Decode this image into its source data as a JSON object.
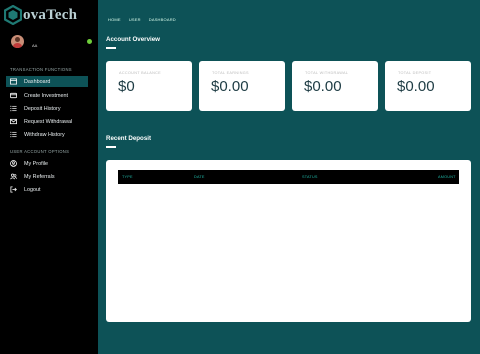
{
  "brand": {
    "text": "ovaTech",
    "accent": "#1f7a74"
  },
  "user": {
    "name": "AA",
    "status_color": "#6fce3b"
  },
  "sidebar": {
    "sections": [
      {
        "label": "TRANSACTION FUNCTIONS"
      },
      {
        "label": "USER ACCOUNT OPTIONS"
      }
    ],
    "items": [
      {
        "label": "Dashboard",
        "icon": "dashboard-icon"
      },
      {
        "label": "Create Investment",
        "icon": "wallet-icon"
      },
      {
        "label": "Deposit History",
        "icon": "list-icon"
      },
      {
        "label": "Request Withdrawal",
        "icon": "envelope-icon"
      },
      {
        "label": "Withdraw History",
        "icon": "list-icon"
      },
      {
        "label": "My Profile",
        "icon": "user-circle-icon"
      },
      {
        "label": "My Referrals",
        "icon": "users-icon"
      },
      {
        "label": "Logout",
        "icon": "logout-icon"
      }
    ]
  },
  "topnav": [
    "HOME",
    "USER",
    "DASHBOARD"
  ],
  "overview": {
    "title": "Account Overview",
    "cards": [
      {
        "label": "ACCOUNT BALANCE",
        "value": "$0"
      },
      {
        "label": "TOTAL EARNINGS",
        "value": "$0.00"
      },
      {
        "label": "TOTAL WITHDRAWAL",
        "value": "$0.00"
      },
      {
        "label": "TOTAL DEPOSIT",
        "value": "$0.00"
      }
    ]
  },
  "recent": {
    "title": "Recent Deposit",
    "columns": [
      "TYPE",
      "DATE",
      "STATUS",
      "AMOUNT"
    ]
  },
  "colors": {
    "background": "#0d5257",
    "sidebar": "#000000",
    "card": "#ffffff",
    "table_header_text": "#20b8a8"
  }
}
